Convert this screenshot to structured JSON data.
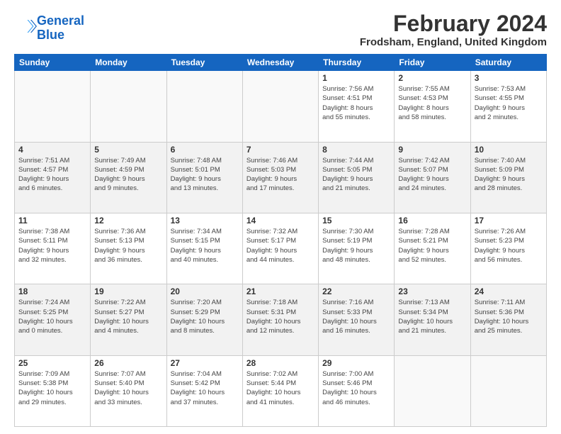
{
  "logo": {
    "line1": "General",
    "line2": "Blue"
  },
  "title": "February 2024",
  "subtitle": "Frodsham, England, United Kingdom",
  "days_header": [
    "Sunday",
    "Monday",
    "Tuesday",
    "Wednesday",
    "Thursday",
    "Friday",
    "Saturday"
  ],
  "weeks": [
    [
      {
        "day": "",
        "info": ""
      },
      {
        "day": "",
        "info": ""
      },
      {
        "day": "",
        "info": ""
      },
      {
        "day": "",
        "info": ""
      },
      {
        "day": "1",
        "info": "Sunrise: 7:56 AM\nSunset: 4:51 PM\nDaylight: 8 hours\nand 55 minutes."
      },
      {
        "day": "2",
        "info": "Sunrise: 7:55 AM\nSunset: 4:53 PM\nDaylight: 8 hours\nand 58 minutes."
      },
      {
        "day": "3",
        "info": "Sunrise: 7:53 AM\nSunset: 4:55 PM\nDaylight: 9 hours\nand 2 minutes."
      }
    ],
    [
      {
        "day": "4",
        "info": "Sunrise: 7:51 AM\nSunset: 4:57 PM\nDaylight: 9 hours\nand 6 minutes."
      },
      {
        "day": "5",
        "info": "Sunrise: 7:49 AM\nSunset: 4:59 PM\nDaylight: 9 hours\nand 9 minutes."
      },
      {
        "day": "6",
        "info": "Sunrise: 7:48 AM\nSunset: 5:01 PM\nDaylight: 9 hours\nand 13 minutes."
      },
      {
        "day": "7",
        "info": "Sunrise: 7:46 AM\nSunset: 5:03 PM\nDaylight: 9 hours\nand 17 minutes."
      },
      {
        "day": "8",
        "info": "Sunrise: 7:44 AM\nSunset: 5:05 PM\nDaylight: 9 hours\nand 21 minutes."
      },
      {
        "day": "9",
        "info": "Sunrise: 7:42 AM\nSunset: 5:07 PM\nDaylight: 9 hours\nand 24 minutes."
      },
      {
        "day": "10",
        "info": "Sunrise: 7:40 AM\nSunset: 5:09 PM\nDaylight: 9 hours\nand 28 minutes."
      }
    ],
    [
      {
        "day": "11",
        "info": "Sunrise: 7:38 AM\nSunset: 5:11 PM\nDaylight: 9 hours\nand 32 minutes."
      },
      {
        "day": "12",
        "info": "Sunrise: 7:36 AM\nSunset: 5:13 PM\nDaylight: 9 hours\nand 36 minutes."
      },
      {
        "day": "13",
        "info": "Sunrise: 7:34 AM\nSunset: 5:15 PM\nDaylight: 9 hours\nand 40 minutes."
      },
      {
        "day": "14",
        "info": "Sunrise: 7:32 AM\nSunset: 5:17 PM\nDaylight: 9 hours\nand 44 minutes."
      },
      {
        "day": "15",
        "info": "Sunrise: 7:30 AM\nSunset: 5:19 PM\nDaylight: 9 hours\nand 48 minutes."
      },
      {
        "day": "16",
        "info": "Sunrise: 7:28 AM\nSunset: 5:21 PM\nDaylight: 9 hours\nand 52 minutes."
      },
      {
        "day": "17",
        "info": "Sunrise: 7:26 AM\nSunset: 5:23 PM\nDaylight: 9 hours\nand 56 minutes."
      }
    ],
    [
      {
        "day": "18",
        "info": "Sunrise: 7:24 AM\nSunset: 5:25 PM\nDaylight: 10 hours\nand 0 minutes."
      },
      {
        "day": "19",
        "info": "Sunrise: 7:22 AM\nSunset: 5:27 PM\nDaylight: 10 hours\nand 4 minutes."
      },
      {
        "day": "20",
        "info": "Sunrise: 7:20 AM\nSunset: 5:29 PM\nDaylight: 10 hours\nand 8 minutes."
      },
      {
        "day": "21",
        "info": "Sunrise: 7:18 AM\nSunset: 5:31 PM\nDaylight: 10 hours\nand 12 minutes."
      },
      {
        "day": "22",
        "info": "Sunrise: 7:16 AM\nSunset: 5:33 PM\nDaylight: 10 hours\nand 16 minutes."
      },
      {
        "day": "23",
        "info": "Sunrise: 7:13 AM\nSunset: 5:34 PM\nDaylight: 10 hours\nand 21 minutes."
      },
      {
        "day": "24",
        "info": "Sunrise: 7:11 AM\nSunset: 5:36 PM\nDaylight: 10 hours\nand 25 minutes."
      }
    ],
    [
      {
        "day": "25",
        "info": "Sunrise: 7:09 AM\nSunset: 5:38 PM\nDaylight: 10 hours\nand 29 minutes."
      },
      {
        "day": "26",
        "info": "Sunrise: 7:07 AM\nSunset: 5:40 PM\nDaylight: 10 hours\nand 33 minutes."
      },
      {
        "day": "27",
        "info": "Sunrise: 7:04 AM\nSunset: 5:42 PM\nDaylight: 10 hours\nand 37 minutes."
      },
      {
        "day": "28",
        "info": "Sunrise: 7:02 AM\nSunset: 5:44 PM\nDaylight: 10 hours\nand 41 minutes."
      },
      {
        "day": "29",
        "info": "Sunrise: 7:00 AM\nSunset: 5:46 PM\nDaylight: 10 hours\nand 46 minutes."
      },
      {
        "day": "",
        "info": ""
      },
      {
        "day": "",
        "info": ""
      }
    ]
  ]
}
